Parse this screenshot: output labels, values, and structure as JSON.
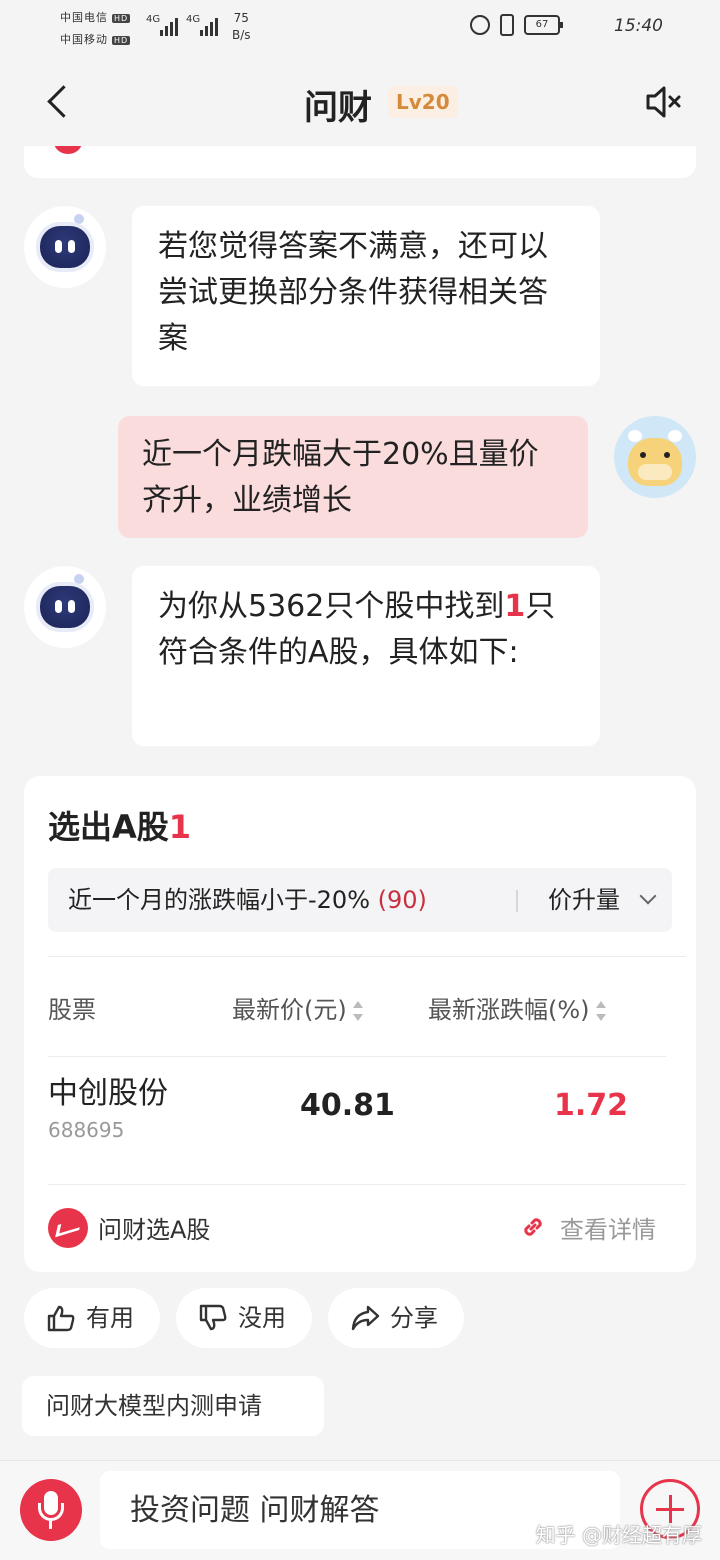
{
  "status_bar": {
    "carrier1": "中国电信",
    "carrier2": "中国移动",
    "hd": "HD",
    "net1": "4G",
    "net2": "4G",
    "speed_value": "75",
    "speed_unit": "B/s",
    "battery": "67",
    "time": "15:40"
  },
  "nav": {
    "title": "问财",
    "level": "Lv20"
  },
  "messages": {
    "bot1": "若您觉得答案不满意，还可以尝试更换部分条件获得相关答案",
    "user1": "近一个月跌幅大于20%且量价齐升，业绩增长",
    "bot2_prefix": "为你从5362只个股中找到",
    "bot2_count": "1",
    "bot2_suffix": "只符合条件的A股，具体如下:"
  },
  "result_card": {
    "title": "选出A股",
    "count": "1",
    "filter1_label": "近一个月的涨跌幅小于-20%",
    "filter1_count": "(90)",
    "filter2_label": "价升量",
    "columns": [
      "股票",
      "最新价(元)",
      "最新涨跌幅(%)"
    ],
    "rows": [
      {
        "name": "中创股份",
        "code": "688695",
        "price": "40.81",
        "change": "1.72"
      }
    ],
    "brand_label": "问财选A股",
    "detail_link": "查看详情"
  },
  "actions": {
    "useful": "有用",
    "useless": "没用",
    "share": "分享"
  },
  "beta_button": "问财大模型内测申请",
  "input": {
    "placeholder": "投资问题 问财解答"
  },
  "watermark": "知乎 @财经超有厚",
  "colors": {
    "accent": "#e8344a",
    "user_bubble": "#fbdcdc",
    "level_badge_bg": "#fbeee2",
    "level_badge_text": "#d48a3a"
  }
}
